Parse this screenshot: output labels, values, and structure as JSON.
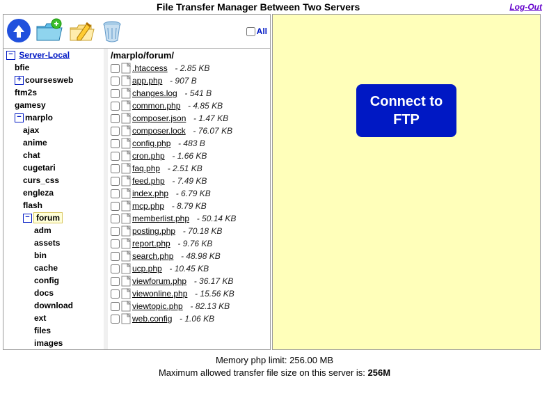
{
  "header": {
    "title": "File Transfer Manager Between Two Servers",
    "logout_label": "Log-Out"
  },
  "toolbar": {
    "select_all_label": "All"
  },
  "tree": {
    "root_label": "Server-Local",
    "nodes": [
      {
        "label": "bfie",
        "type": "plain"
      },
      {
        "label": "coursesweb",
        "type": "plus"
      },
      {
        "label": "ftm2s",
        "type": "plain"
      },
      {
        "label": "gamesy",
        "type": "plain"
      },
      {
        "label": "marplo",
        "type": "minus",
        "children": [
          {
            "label": "ajax"
          },
          {
            "label": "anime"
          },
          {
            "label": "chat"
          },
          {
            "label": "cugetari"
          },
          {
            "label": "curs_css"
          },
          {
            "label": "engleza"
          },
          {
            "label": "flash"
          },
          {
            "label": "forum",
            "type": "minus",
            "highlight": true,
            "children": [
              {
                "label": "adm"
              },
              {
                "label": "assets"
              },
              {
                "label": "bin"
              },
              {
                "label": "cache"
              },
              {
                "label": "config"
              },
              {
                "label": "docs"
              },
              {
                "label": "download"
              },
              {
                "label": "ext"
              },
              {
                "label": "files"
              },
              {
                "label": "images"
              }
            ]
          }
        ]
      }
    ]
  },
  "files": {
    "path": "/marplo/forum/",
    "items": [
      {
        "name": ".htaccess",
        "size": "2.85 KB"
      },
      {
        "name": "app.php",
        "size": "907 B"
      },
      {
        "name": "changes.log",
        "size": "541 B"
      },
      {
        "name": "common.php",
        "size": "4.85 KB"
      },
      {
        "name": "composer.json",
        "size": "1.47 KB"
      },
      {
        "name": "composer.lock",
        "size": "76.07 KB"
      },
      {
        "name": "config.php",
        "size": "483 B"
      },
      {
        "name": "cron.php",
        "size": "1.66 KB"
      },
      {
        "name": "faq.php",
        "size": "2.51 KB"
      },
      {
        "name": "feed.php",
        "size": "7.49 KB"
      },
      {
        "name": "index.php",
        "size": "6.79 KB"
      },
      {
        "name": "mcp.php",
        "size": "8.79 KB"
      },
      {
        "name": "memberlist.php",
        "size": "50.14 KB"
      },
      {
        "name": "posting.php",
        "size": "70.18 KB"
      },
      {
        "name": "report.php",
        "size": "9.76 KB"
      },
      {
        "name": "search.php",
        "size": "48.98 KB"
      },
      {
        "name": "ucp.php",
        "size": "10.45 KB"
      },
      {
        "name": "viewforum.php",
        "size": "36.17 KB"
      },
      {
        "name": "viewonline.php",
        "size": "15.56 KB"
      },
      {
        "name": "viewtopic.php",
        "size": "82.13 KB"
      },
      {
        "name": "web.config",
        "size": "1.06 KB"
      }
    ]
  },
  "right": {
    "connect_label": "Connect to FTP"
  },
  "footer": {
    "memory_prefix": "Memory php limit: ",
    "memory_value": "256.00 MB",
    "max_prefix": "Maximum allowed transfer file size on this server is: ",
    "max_value": "256M"
  }
}
